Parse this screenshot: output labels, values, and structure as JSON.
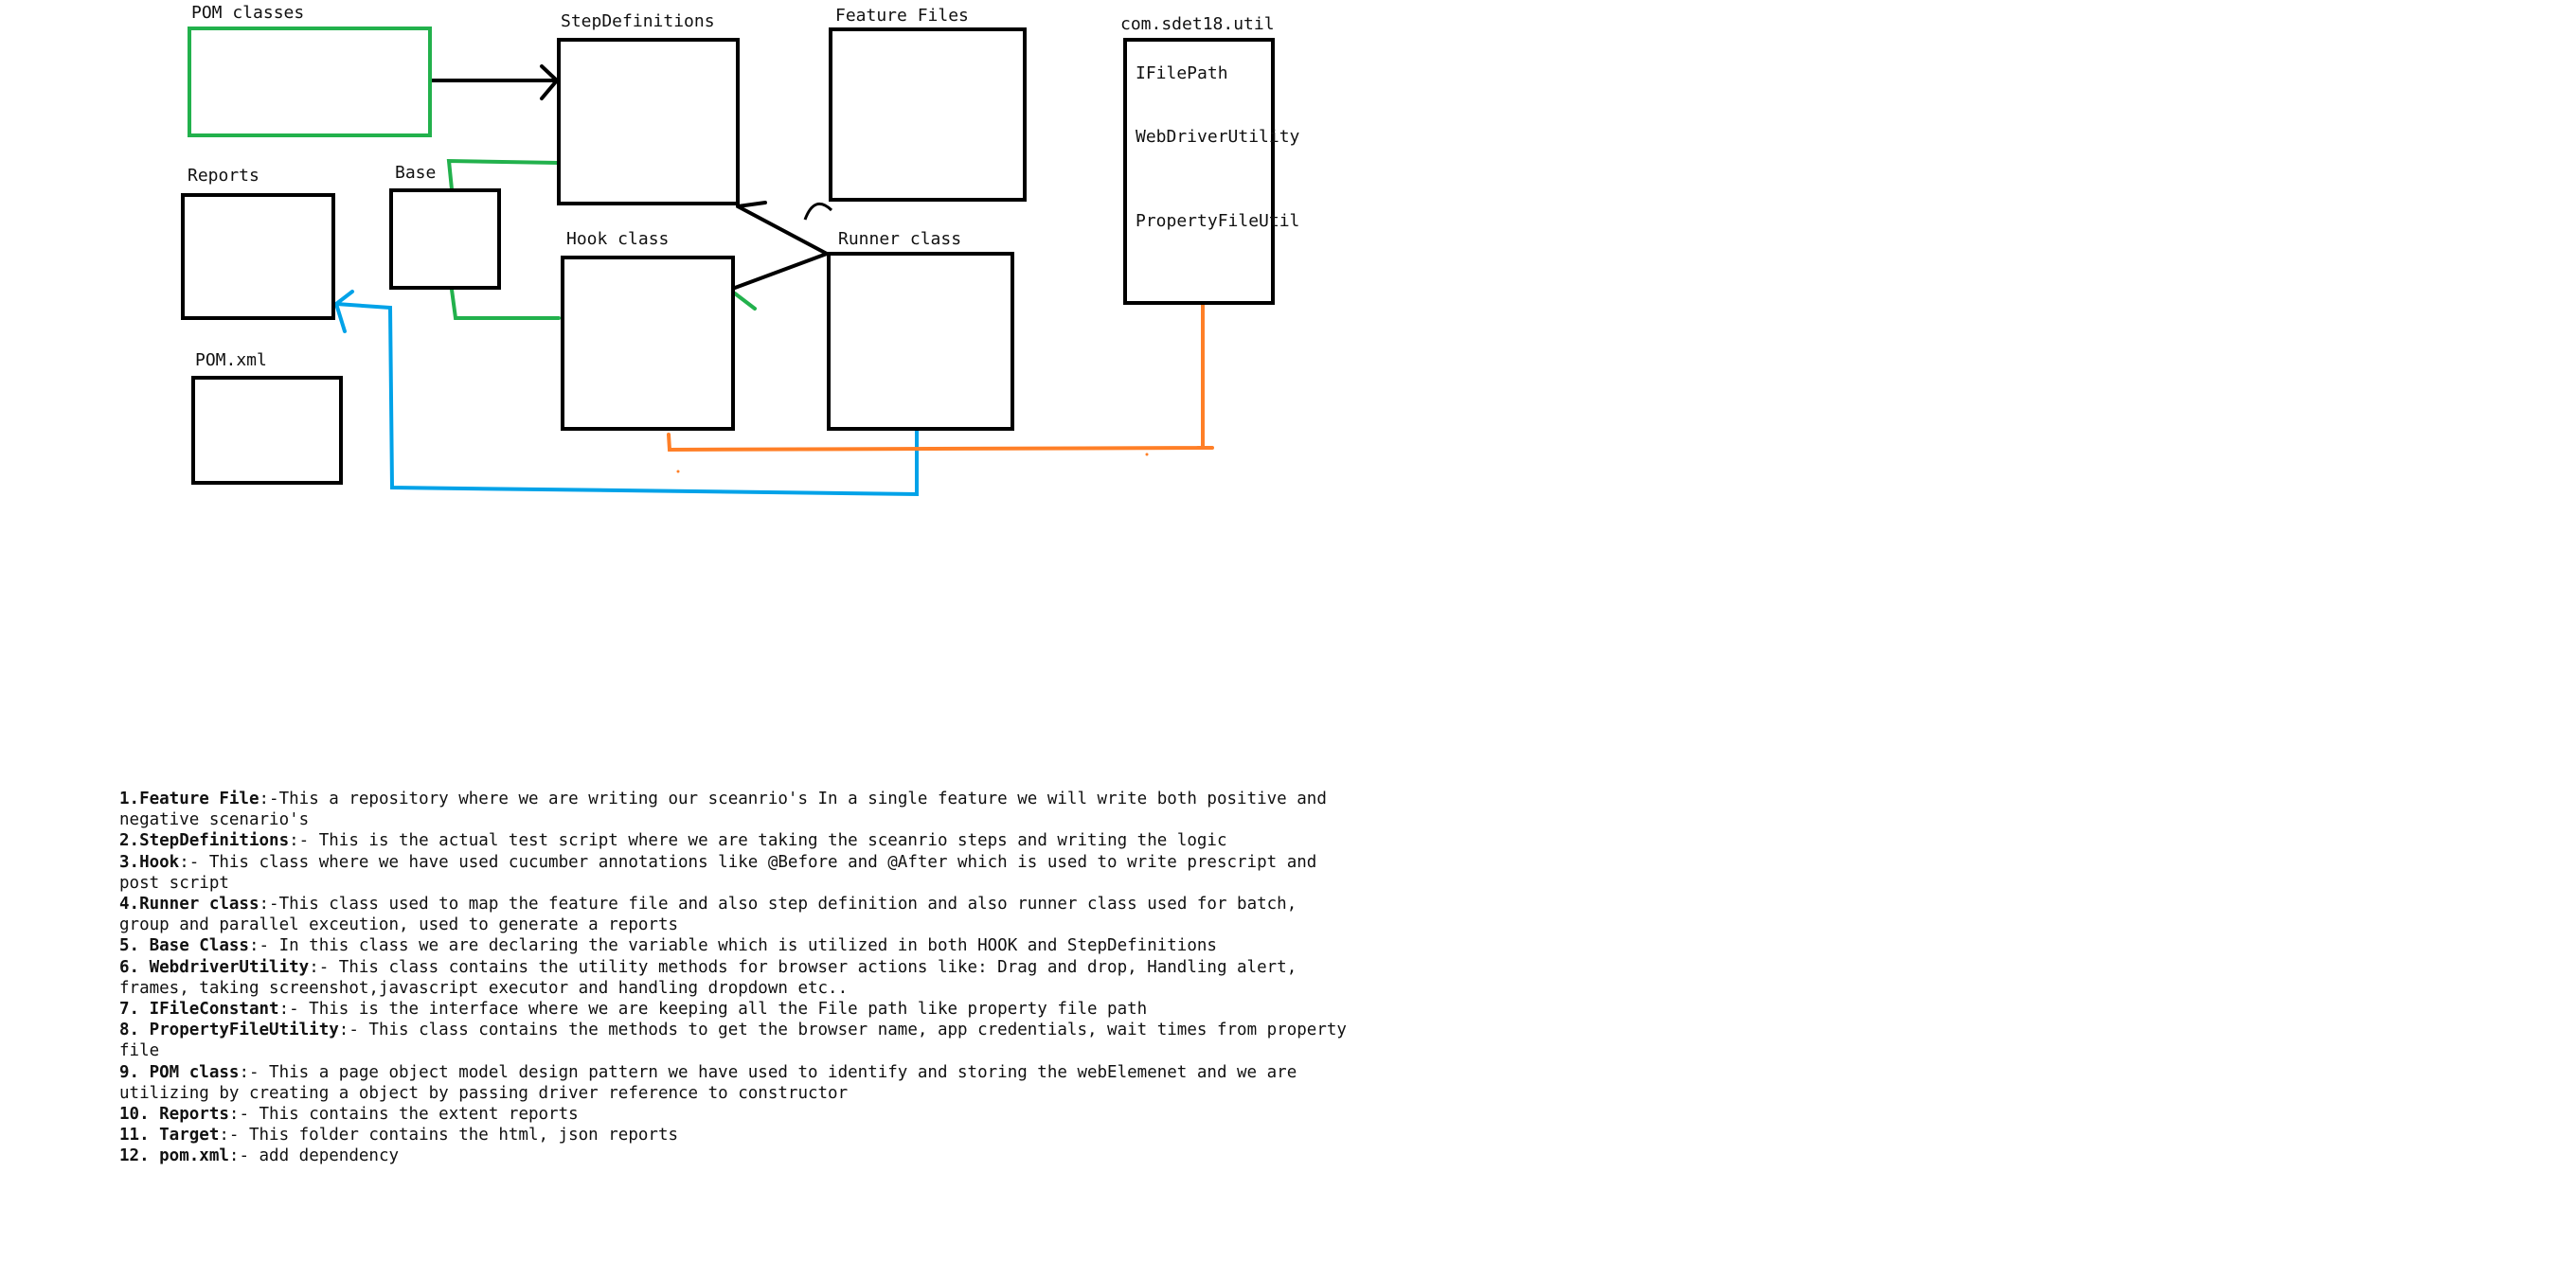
{
  "diagram": {
    "nodes": {
      "pom_classes": "POM classes",
      "step_definitions": "StepDefinitions",
      "feature_files": "Feature Files",
      "util_package": "com.sdet18.util",
      "util_items": [
        "IFilePath",
        "WebDriverUtility",
        "PropertyFileUtil"
      ],
      "reports": "Reports",
      "base": "Base",
      "hook_class": "Hook class",
      "runner_class": "Runner class",
      "pom_xml": "POM.xml"
    },
    "colors": {
      "box_border": "#000000",
      "pom_classes_border": "#22b14c",
      "green_connector": "#22b14c",
      "blue_connector": "#00a2e8",
      "orange_connector": "#ff7f27"
    }
  },
  "notes": [
    {
      "term": "1.Feature File",
      "text": ":-This a repository where we are writing our sceanrio's In a single feature we will write both positive and negative scenario's"
    },
    {
      "term": "2.StepDefinitions",
      "text": ":- This is the actual test script where we are taking the sceanrio steps and writing the logic"
    },
    {
      "term": "3.Hook",
      "text": ":- This class where we have used cucumber annotations like @Before and @After which is used to write prescript and post script"
    },
    {
      "term": "4.Runner class",
      "text": ":-This class used to map the feature file and also step definition and also runner class used for batch, group and parallel exceution, used to generate a reports"
    },
    {
      "term": "5. Base Class",
      "text": ":- In this class we are declaring the variable which is utilized in both HOOK and StepDefinitions"
    },
    {
      "term": "6. WebdriverUtility",
      "text": ":- This class contains the utility methods for browser actions like: Drag and drop, Handling alert, frames, taking screenshot,javascript executor and handling dropdown etc.."
    },
    {
      "term": "7. IFileConstant",
      "text": ":- This is the interface where we are keeping all the File path like property file path"
    },
    {
      "term": "8. PropertyFileUtility",
      "text": ":- This class contains the methods to get the browser name, app credentials, wait times from property file"
    },
    {
      "term": "9. POM class",
      "text": ":- This a page object model design pattern we have used to identify and storing the webElemenet and we are utilizing by creating a object by passing driver reference to constructor"
    },
    {
      "term": "10. Reports",
      "text": ":- This contains the extent reports"
    },
    {
      "term": "11. Target",
      "text": ":- This folder contains the html, json reports"
    },
    {
      "term": "12. pom.xml",
      "text": ":- add dependency"
    }
  ]
}
